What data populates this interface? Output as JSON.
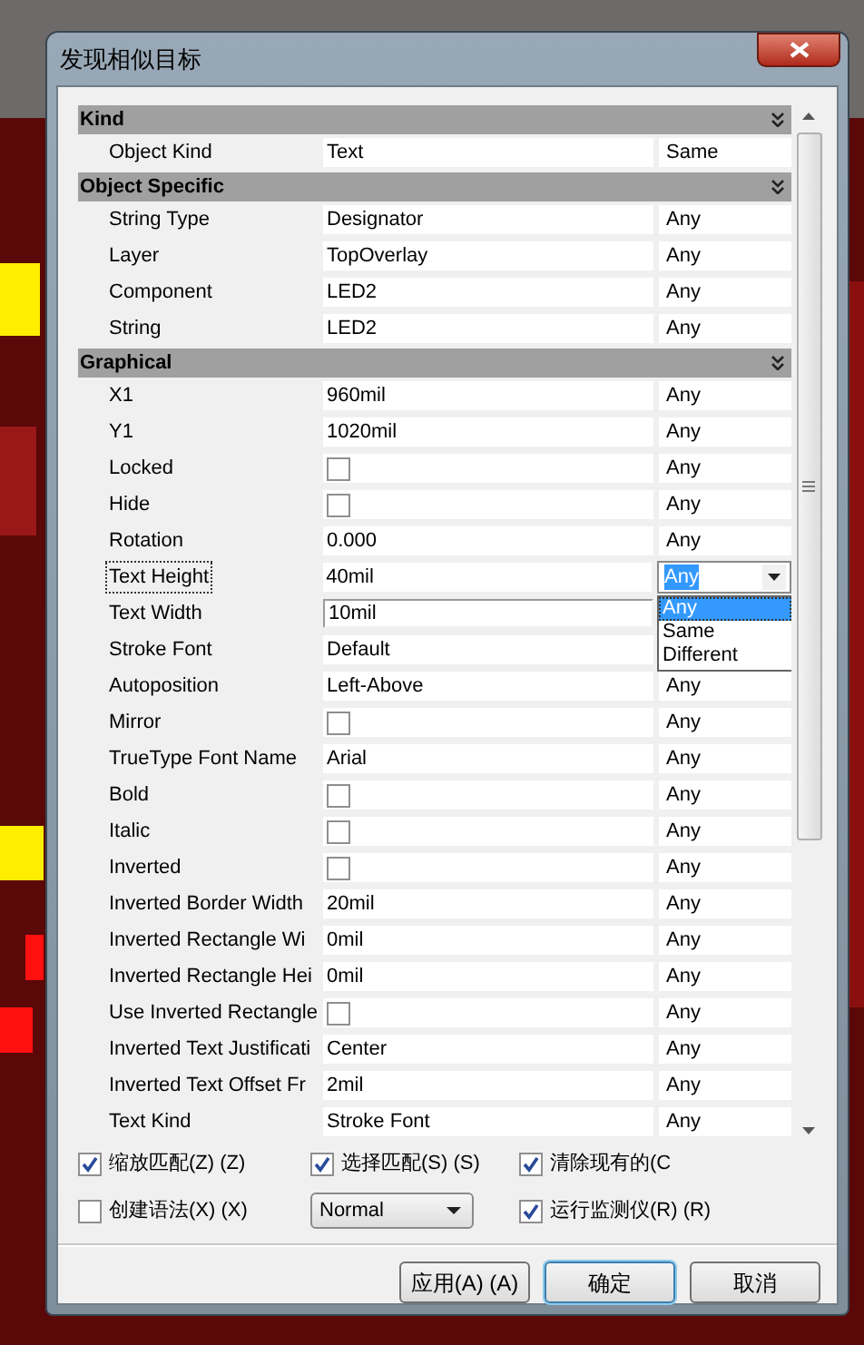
{
  "window": {
    "title": "发现相似目标"
  },
  "sections": [
    {
      "title": "Kind",
      "rows": [
        {
          "label": "Object Kind",
          "kind": "text",
          "value": "Text",
          "compare": {
            "kind": "text",
            "value": "Same"
          },
          "focused": false,
          "editing": false
        }
      ]
    },
    {
      "title": "Object Specific",
      "rows": [
        {
          "label": "String Type",
          "kind": "text",
          "value": "Designator",
          "compare": {
            "kind": "text",
            "value": "Any"
          },
          "focused": false,
          "editing": false
        },
        {
          "label": "Layer",
          "kind": "text",
          "value": "TopOverlay",
          "compare": {
            "kind": "text",
            "value": "Any"
          },
          "focused": false,
          "editing": false
        },
        {
          "label": "Component",
          "kind": "text",
          "value": "LED2",
          "compare": {
            "kind": "text",
            "value": "Any"
          },
          "focused": false,
          "editing": false
        },
        {
          "label": "String",
          "kind": "text",
          "value": "LED2",
          "compare": {
            "kind": "text",
            "value": "Any"
          },
          "focused": false,
          "editing": false
        }
      ]
    },
    {
      "title": "Graphical",
      "rows": [
        {
          "label": "X1",
          "kind": "text",
          "value": "960mil",
          "compare": {
            "kind": "text",
            "value": "Any"
          },
          "focused": false,
          "editing": false
        },
        {
          "label": "Y1",
          "kind": "text",
          "value": "1020mil",
          "compare": {
            "kind": "text",
            "value": "Any"
          },
          "focused": false,
          "editing": false
        },
        {
          "label": "Locked",
          "kind": "checkbox",
          "checked": false,
          "compare": {
            "kind": "text",
            "value": "Any"
          },
          "focused": false,
          "editing": false
        },
        {
          "label": "Hide",
          "kind": "checkbox",
          "checked": false,
          "compare": {
            "kind": "text",
            "value": "Any"
          },
          "focused": false,
          "editing": false
        },
        {
          "label": "Rotation",
          "kind": "text",
          "value": "0.000",
          "compare": {
            "kind": "text",
            "value": "Any"
          },
          "focused": false,
          "editing": false
        },
        {
          "label": "Text Height",
          "kind": "text",
          "value": "40mil",
          "compare": {
            "kind": "dropdown",
            "value": "Any",
            "options": [
              {
                "label": "Any",
                "selected": true
              },
              {
                "label": "Same",
                "selected": false
              },
              {
                "label": "Different",
                "selected": false
              }
            ]
          },
          "focused": true,
          "editing": false
        },
        {
          "label": "Text Width",
          "kind": "text",
          "value": "10mil",
          "focused": false,
          "editing": true
        },
        {
          "label": "Stroke Font",
          "kind": "text",
          "value": "Default",
          "focused": false,
          "editing": false
        },
        {
          "label": "Autoposition",
          "kind": "text",
          "value": "Left-Above",
          "compare": {
            "kind": "text",
            "value": "Any"
          },
          "focused": false,
          "editing": false
        },
        {
          "label": "Mirror",
          "kind": "checkbox",
          "checked": false,
          "compare": {
            "kind": "text",
            "value": "Any"
          },
          "focused": false,
          "editing": false
        },
        {
          "label": "TrueType Font Name",
          "kind": "text",
          "value": "Arial",
          "compare": {
            "kind": "text",
            "value": "Any"
          },
          "focused": false,
          "editing": false
        },
        {
          "label": "Bold",
          "kind": "checkbox",
          "checked": false,
          "compare": {
            "kind": "text",
            "value": "Any"
          },
          "focused": false,
          "editing": false
        },
        {
          "label": "Italic",
          "kind": "checkbox",
          "checked": false,
          "compare": {
            "kind": "text",
            "value": "Any"
          },
          "focused": false,
          "editing": false
        },
        {
          "label": "Inverted",
          "kind": "checkbox",
          "checked": false,
          "compare": {
            "kind": "text",
            "value": "Any"
          },
          "focused": false,
          "editing": false
        },
        {
          "label": "Inverted Border Width",
          "kind": "text",
          "value": "20mil",
          "compare": {
            "kind": "text",
            "value": "Any"
          },
          "focused": false,
          "editing": false
        },
        {
          "label": "Inverted Rectangle Wi",
          "kind": "text",
          "value": "0mil",
          "compare": {
            "kind": "text",
            "value": "Any"
          },
          "focused": false,
          "editing": false
        },
        {
          "label": "Inverted Rectangle Hei",
          "kind": "text",
          "value": "0mil",
          "compare": {
            "kind": "text",
            "value": "Any"
          },
          "focused": false,
          "editing": false
        },
        {
          "label": "Use Inverted Rectangle",
          "kind": "checkbox",
          "checked": false,
          "compare": {
            "kind": "text",
            "value": "Any"
          },
          "focused": false,
          "editing": false
        },
        {
          "label": "Inverted Text Justificati",
          "kind": "text",
          "value": "Center",
          "compare": {
            "kind": "text",
            "value": "Any"
          },
          "focused": false,
          "editing": false
        },
        {
          "label": "Inverted Text Offset Fr",
          "kind": "text",
          "value": "2mil",
          "compare": {
            "kind": "text",
            "value": "Any"
          },
          "focused": false,
          "editing": false
        },
        {
          "label": "Text Kind",
          "kind": "text",
          "value": "Stroke Font",
          "compare": {
            "kind": "text",
            "value": "Any"
          },
          "focused": false,
          "editing": false
        }
      ]
    }
  ],
  "options": [
    {
      "kind": "checkbox",
      "label": "缩放匹配(Z) (Z)",
      "checked": true
    },
    {
      "kind": "checkbox",
      "label": "选择匹配(S) (S)",
      "checked": true
    },
    {
      "kind": "checkbox",
      "label": "清除现有的(C",
      "checked": true
    },
    {
      "kind": "checkbox",
      "label": "创建语法(X) (X)",
      "checked": false
    },
    {
      "kind": "select",
      "value": "Normal"
    },
    {
      "kind": "checkbox",
      "label": "运行监测仪(R) (R)",
      "checked": true
    }
  ],
  "buttons": [
    {
      "label": "应用(A) (A)",
      "default": false
    },
    {
      "label": "确定",
      "default": true
    },
    {
      "label": "取消",
      "default": false
    }
  ]
}
